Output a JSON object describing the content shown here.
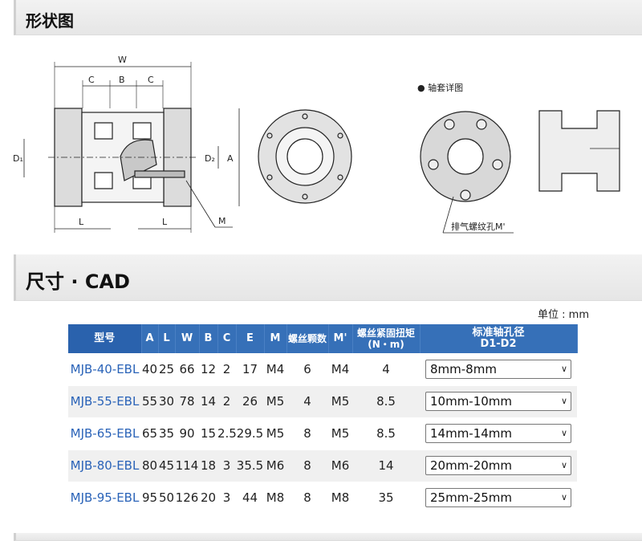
{
  "sections": {
    "shape_title": "形状图",
    "size_title": "尺寸 · CAD"
  },
  "drawing": {
    "dim_W": "W",
    "dim_C": "C",
    "dim_B": "B",
    "dim_D1": "D₁",
    "dim_D2": "D₂",
    "dim_A": "A",
    "dim_L": "L",
    "dim_M": "M",
    "sleeve_title": "● 轴套详图",
    "vent_hole": "排气螺纹孔M'"
  },
  "unit_label": "单位 : mm",
  "table": {
    "headers": [
      "型号",
      "A",
      "L",
      "W",
      "B",
      "C",
      "E",
      "M",
      "螺丝颗数",
      "M'",
      "螺丝紧固扭矩\n(N・m)",
      "标准轴孔径\nD1-D2"
    ],
    "rows": [
      {
        "model": "MJB-40-EBL",
        "A": "40",
        "L": "25",
        "W": "66",
        "B": "12",
        "C": "2",
        "E": "17",
        "M": "M4",
        "count": "6",
        "Mp": "M4",
        "torque": "4",
        "bore": "8mm-8mm"
      },
      {
        "model": "MJB-55-EBL",
        "A": "55",
        "L": "30",
        "W": "78",
        "B": "14",
        "C": "2",
        "E": "26",
        "M": "M5",
        "count": "4",
        "Mp": "M5",
        "torque": "8.5",
        "bore": "10mm-10mm"
      },
      {
        "model": "MJB-65-EBL",
        "A": "65",
        "L": "35",
        "W": "90",
        "B": "15",
        "C": "2.5",
        "E": "29.5",
        "M": "M5",
        "count": "8",
        "Mp": "M5",
        "torque": "8.5",
        "bore": "14mm-14mm"
      },
      {
        "model": "MJB-80-EBL",
        "A": "80",
        "L": "45",
        "W": "114",
        "B": "18",
        "C": "3",
        "E": "35.5",
        "M": "M6",
        "count": "8",
        "Mp": "M6",
        "torque": "14",
        "bore": "20mm-20mm"
      },
      {
        "model": "MJB-95-EBL",
        "A": "95",
        "L": "50",
        "W": "126",
        "B": "20",
        "C": "3",
        "E": "44",
        "M": "M8",
        "count": "8",
        "Mp": "M8",
        "torque": "35",
        "bore": "25mm-25mm"
      }
    ]
  },
  "colors": {
    "header_blue": "#3670b8",
    "model_blue": "#2a63b8",
    "stripe_gray": "#f0f0f0"
  }
}
